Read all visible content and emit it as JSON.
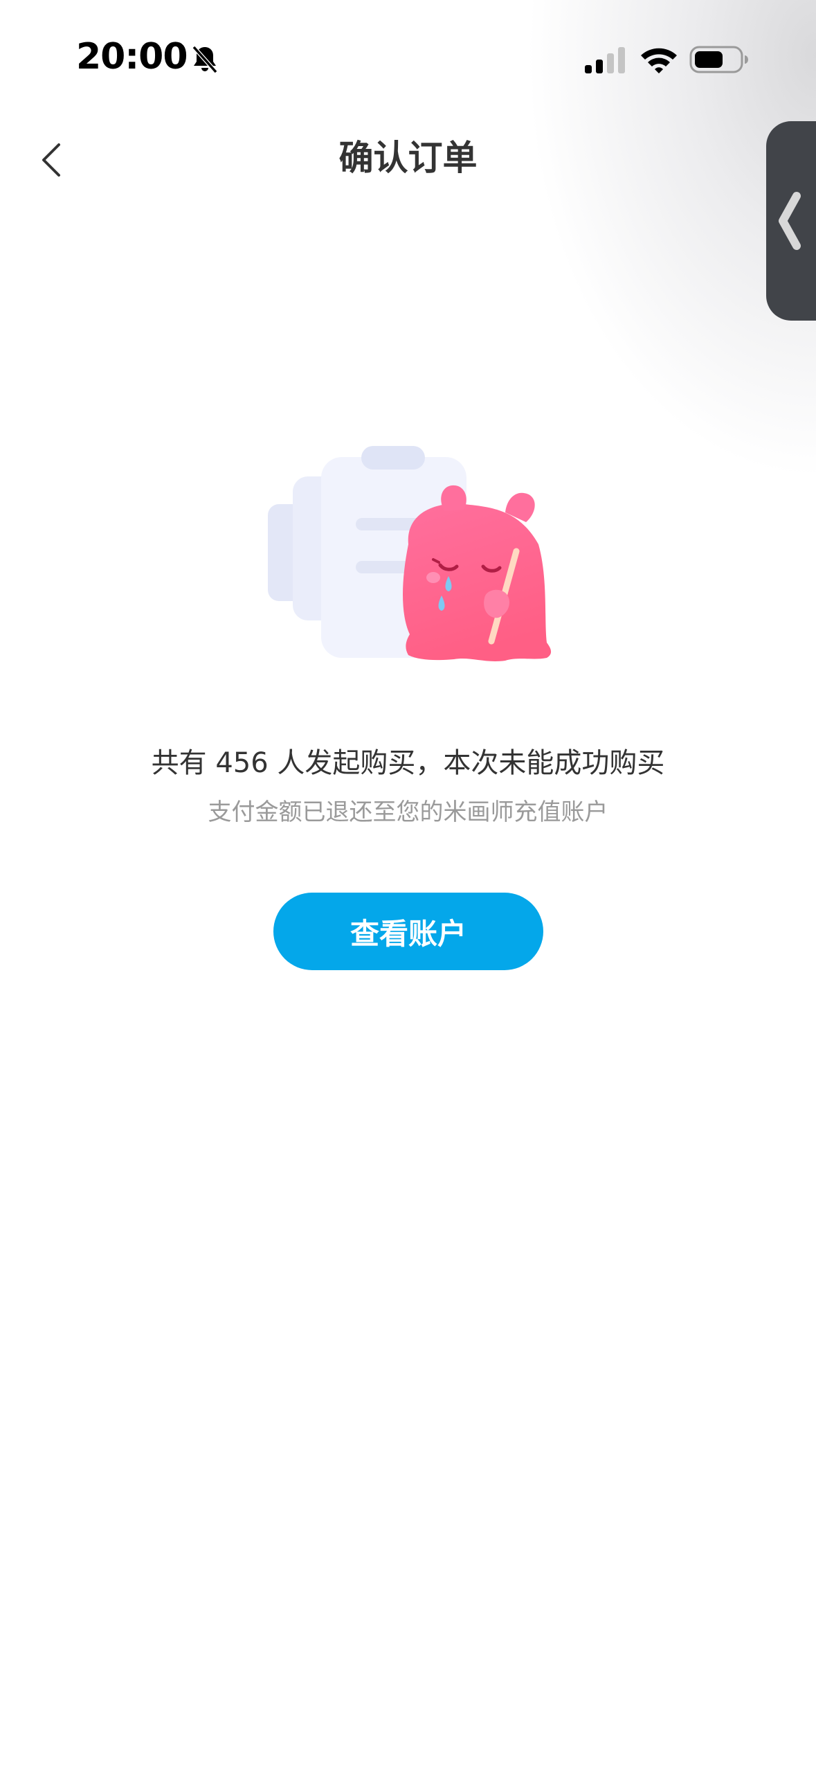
{
  "status_bar": {
    "time": "20:00",
    "icons": [
      "bell-slash-icon",
      "cellular-signal-icon",
      "wifi-icon",
      "battery-icon"
    ]
  },
  "nav": {
    "title": "确认订单",
    "back_icon": "chevron-left-icon"
  },
  "side_tab": {
    "icon": "chevron-left-icon"
  },
  "illustration": {
    "icon": "empty-order-crying-mascot-illustration"
  },
  "result": {
    "message": "共有 456 人发起购买，本次未能成功购买",
    "sub_message": "支付金额已退还至您的米画师充值账户"
  },
  "actions": {
    "view_account_label": "查看账户"
  },
  "colors": {
    "primary": "#04a7ea",
    "title_text": "#333333",
    "sub_text": "#9a9a9a",
    "side_tab_bg": "#414449",
    "mascot_pink": "#ff6b91"
  }
}
